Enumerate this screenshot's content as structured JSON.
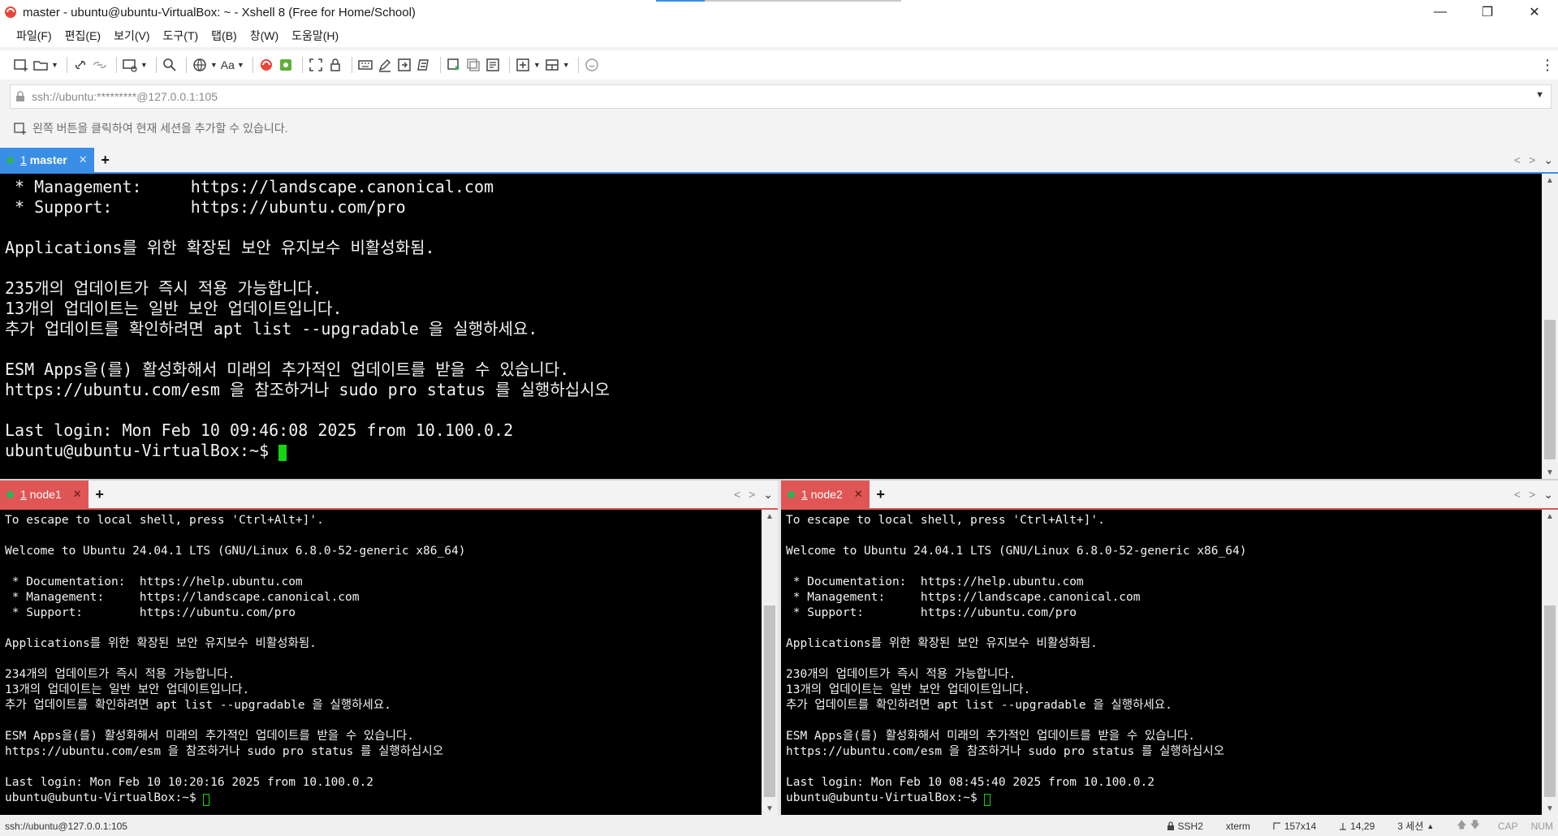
{
  "window": {
    "title": "master - ubuntu@ubuntu-VirtualBox: ~ - Xshell 8 (Free for Home/School)",
    "controls": {
      "minimize": "—",
      "restore": "❐",
      "close": "✕"
    }
  },
  "menu": {
    "items": [
      "파일(F)",
      "편집(E)",
      "보기(V)",
      "도구(T)",
      "탭(B)",
      "창(W)",
      "도움말(H)"
    ]
  },
  "toolbar": {
    "font_label": "Aa",
    "more": "⋮"
  },
  "address": {
    "value": "ssh://ubuntu:*********@127.0.0.1:105"
  },
  "hint": {
    "text": "왼쪽 버튼을 클릭하여 현재 세션을 추가할 수 있습니다."
  },
  "colors": {
    "active_tab": "#3a8ee6",
    "inactive_tab": "#e05555",
    "status_dot": "#2fb35a",
    "cursor": "#12d612"
  },
  "panes": {
    "master": {
      "tab_number": "1",
      "tab_label": "master",
      "close": "✕",
      "add": "+",
      "lines": [
        " * Management:     https://landscape.canonical.com",
        " * Support:        https://ubuntu.com/pro",
        "",
        "Applications를 위한 확장된 보안 유지보수 비활성화됨.",
        "",
        "235개의 업데이트가 즉시 적용 가능합니다.",
        "13개의 업데이트는 일반 보안 업데이트입니다.",
        "추가 업데이트를 확인하려면 apt list --upgradable 을 실행하세요.",
        "",
        "ESM Apps을(를) 활성화해서 미래의 추가적인 업데이트를 받을 수 있습니다.",
        "https://ubuntu.com/esm 을 참조하거나 sudo pro status 를 실행하십시오",
        "",
        "Last login: Mon Feb 10 09:46:08 2025 from 10.100.0.2"
      ],
      "prompt": "ubuntu@ubuntu-VirtualBox:~$ "
    },
    "node1": {
      "tab_number": "1",
      "tab_label": "node1",
      "close": "✕",
      "add": "+",
      "lines": [
        "To escape to local shell, press 'Ctrl+Alt+]'.",
        "",
        "Welcome to Ubuntu 24.04.1 LTS (GNU/Linux 6.8.0-52-generic x86_64)",
        "",
        " * Documentation:  https://help.ubuntu.com",
        " * Management:     https://landscape.canonical.com",
        " * Support:        https://ubuntu.com/pro",
        "",
        "Applications를 위한 확장된 보안 유지보수 비활성화됨.",
        "",
        "234개의 업데이트가 즉시 적용 가능합니다.",
        "13개의 업데이트는 일반 보안 업데이트입니다.",
        "추가 업데이트를 확인하려면 apt list --upgradable 을 실행하세요.",
        "",
        "ESM Apps을(를) 활성화해서 미래의 추가적인 업데이트를 받을 수 있습니다.",
        "https://ubuntu.com/esm 을 참조하거나 sudo pro status 를 실행하십시오",
        "",
        "Last login: Mon Feb 10 10:20:16 2025 from 10.100.0.2"
      ],
      "prompt": "ubuntu@ubuntu-VirtualBox:~$ "
    },
    "node2": {
      "tab_number": "1",
      "tab_label": "node2",
      "close": "✕",
      "add": "+",
      "lines": [
        "To escape to local shell, press 'Ctrl+Alt+]'.",
        "",
        "Welcome to Ubuntu 24.04.1 LTS (GNU/Linux 6.8.0-52-generic x86_64)",
        "",
        " * Documentation:  https://help.ubuntu.com",
        " * Management:     https://landscape.canonical.com",
        " * Support:        https://ubuntu.com/pro",
        "",
        "Applications를 위한 확장된 보안 유지보수 비활성화됨.",
        "",
        "230개의 업데이트가 즉시 적용 가능합니다.",
        "13개의 업데이트는 일반 보안 업데이트입니다.",
        "추가 업데이트를 확인하려면 apt list --upgradable 을 실행하세요.",
        "",
        "ESM Apps을(를) 활성화해서 미래의 추가적인 업데이트를 받을 수 있습니다.",
        "https://ubuntu.com/esm 을 참조하거나 sudo pro status 를 실행하십시오",
        "",
        "Last login: Mon Feb 10 08:45:40 2025 from 10.100.0.2"
      ],
      "prompt": "ubuntu@ubuntu-VirtualBox:~$ "
    }
  },
  "status": {
    "connection": "ssh://ubuntu@127.0.0.1:105",
    "protocol": "SSH2",
    "term_type": "xterm",
    "size": "157x14",
    "cursor_pos": "14,29",
    "sessions": "3 세션",
    "cap": "CAP",
    "num": "NUM"
  }
}
